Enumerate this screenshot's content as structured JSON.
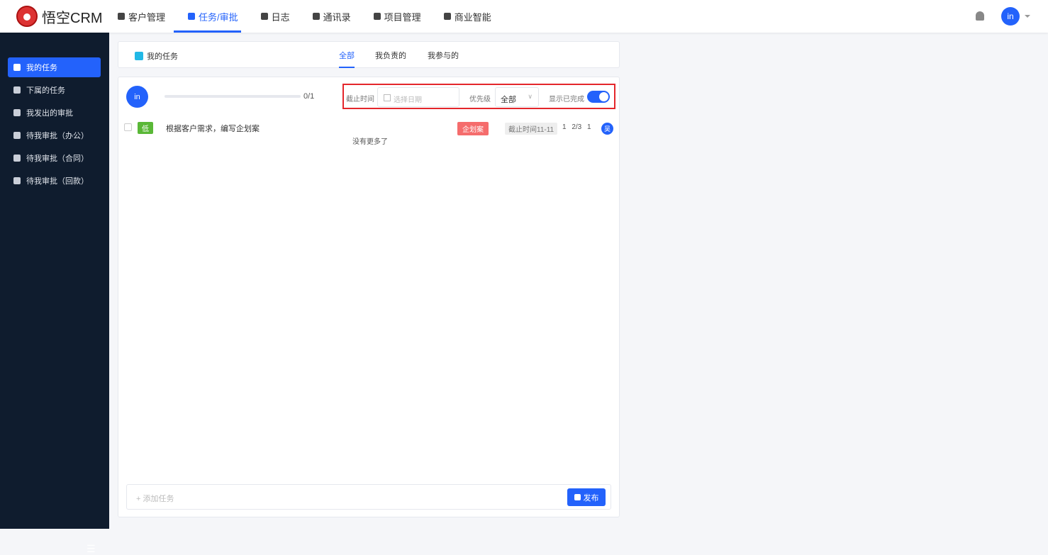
{
  "app": {
    "logo": "悟空CRM",
    "user": "in"
  },
  "nav": [
    "客户管理",
    "任务/审批",
    "日志",
    "通讯录",
    "项目管理",
    "商业智能"
  ],
  "sidebar": [
    "我的任务",
    "下属的任务",
    "我发出的审批",
    "待我审批（办公）",
    "待我审批（合同）",
    "待我审批（回款）"
  ],
  "header": {
    "title": "我的任务",
    "tabs": [
      "全部",
      "我负责的",
      "我参与的"
    ]
  },
  "toolbar": {
    "avatar": "in",
    "progress": "0/1",
    "progress_value": 0,
    "deadline_label": "截止时间",
    "date_placeholder": "选择日期",
    "priority_label": "优先级",
    "priority_value": "全部",
    "show_done_label": "显示已完成",
    "show_done": true
  },
  "task": {
    "priority": "低",
    "name": "根据客户需求，编写企划案",
    "tag": "企划案",
    "due": "截止时间11-11",
    "stats": "1 2/3 1",
    "owner": "吴"
  },
  "no_more": "没有更多了",
  "add": {
    "placeholder": "+ 添加任务",
    "publish": "发布"
  },
  "colors": {
    "accent": "#2362fb",
    "sidebar": "#0f1c2e",
    "tag": "#f56c6c",
    "low": "#5ab837"
  }
}
